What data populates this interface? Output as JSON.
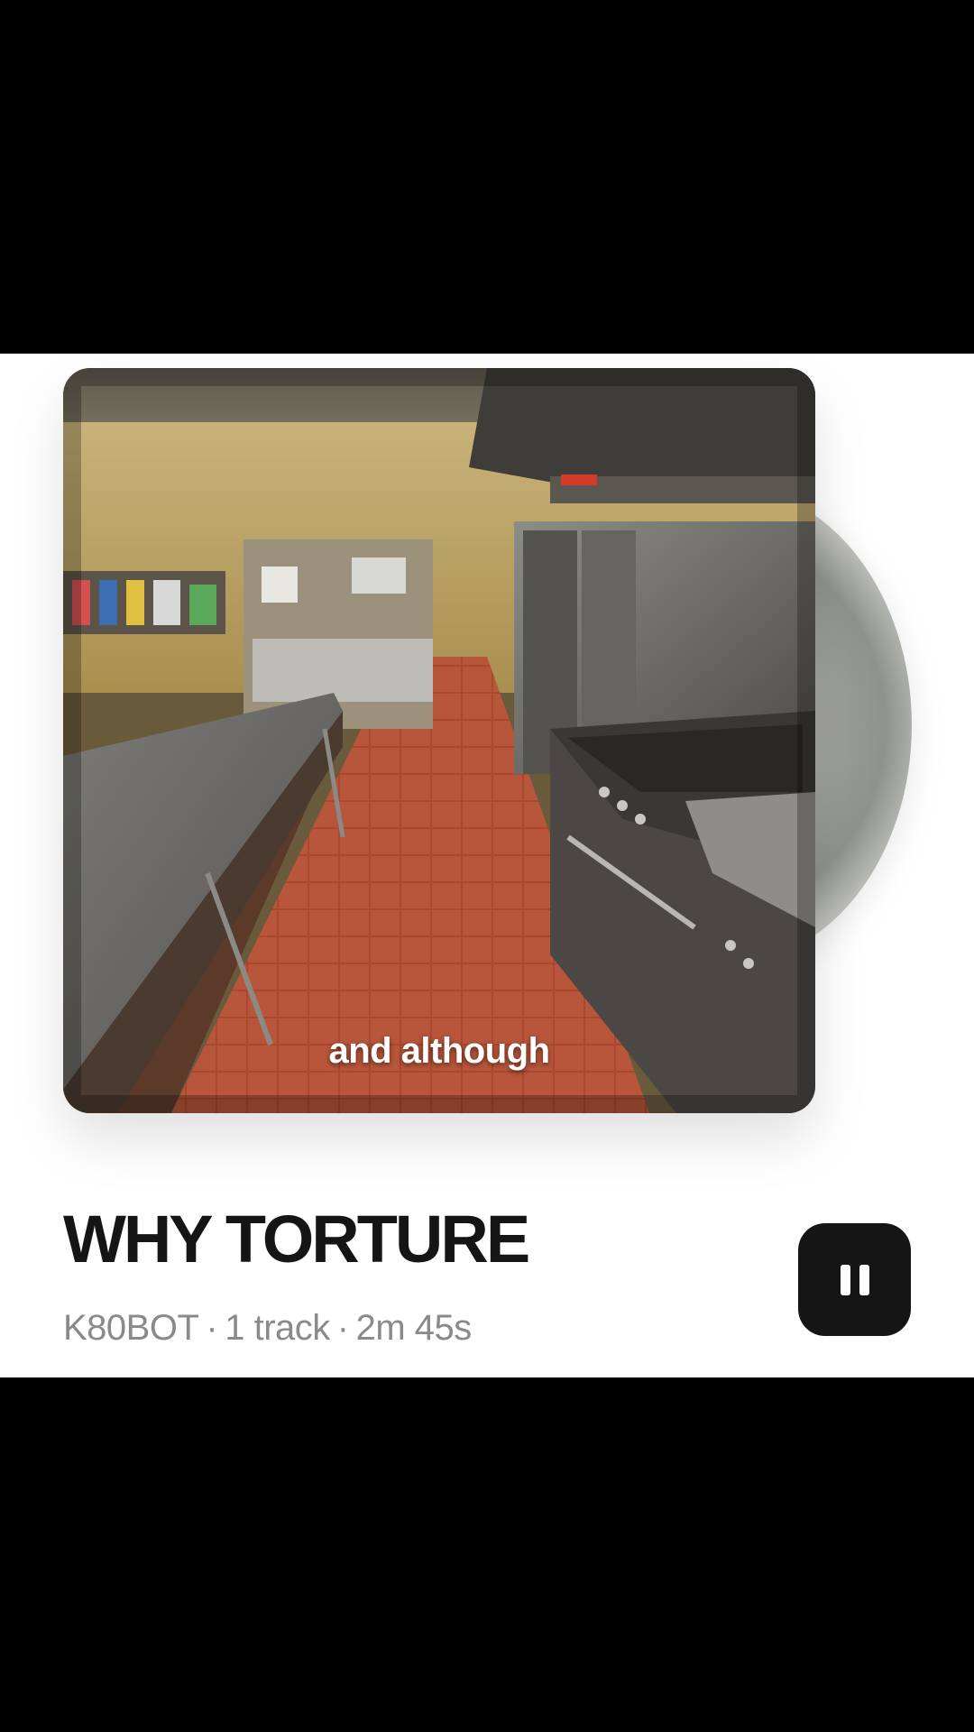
{
  "playlist": {
    "title": "WHY TORTURE",
    "artist": "K80BOT",
    "track_count": "1 track",
    "duration": "2m 45s",
    "separator": "·"
  },
  "artwork": {
    "caption": "and although"
  },
  "controls": {
    "pause_icon": "pause-icon"
  }
}
